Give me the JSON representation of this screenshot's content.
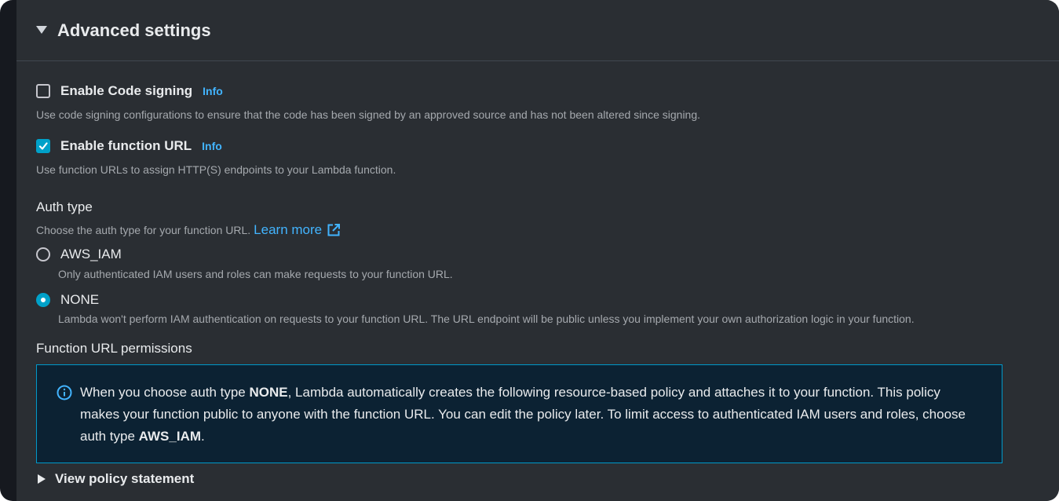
{
  "section": {
    "title": "Advanced settings"
  },
  "code_signing": {
    "label": "Enable Code signing",
    "info": "Info",
    "checked": false,
    "description": "Use code signing configurations to ensure that the code has been signed by an approved source and has not been altered since signing."
  },
  "function_url": {
    "label": "Enable function URL",
    "info": "Info",
    "checked": true,
    "description": "Use function URLs to assign HTTP(S) endpoints to your Lambda function."
  },
  "auth_type": {
    "label": "Auth type",
    "description": "Choose the auth type for your function URL.",
    "learn_more": "Learn more",
    "options": [
      {
        "label": "AWS_IAM",
        "description": "Only authenticated IAM users and roles can make requests to your function URL.",
        "selected": false
      },
      {
        "label": "NONE",
        "description": "Lambda won't perform IAM authentication on requests to your function URL. The URL endpoint will be public unless you implement your own authorization logic in your function.",
        "selected": true
      }
    ]
  },
  "permissions": {
    "label": "Function URL permissions",
    "alert": {
      "text_1": "When you choose auth type ",
      "bold_1": "NONE",
      "text_2": ", Lambda automatically creates the following resource-based policy and attaches it to your function. This policy makes your function public to anyone with the function URL. You can edit the policy later. To limit access to authenticated IAM users and roles, choose auth type ",
      "bold_2": "AWS_IAM",
      "text_3": "."
    }
  },
  "policy": {
    "label": "View policy statement"
  },
  "colors": {
    "accent": "#00a1c9",
    "link": "#42b4ff",
    "panel_bg": "#2a2e33",
    "alert_bg": "#0c2233",
    "alert_border": "#0099c9"
  },
  "icons": {
    "header_toggle": "caret-down-icon",
    "policy_toggle": "caret-right-icon",
    "external_link": "external-link-icon",
    "alert": "info-circle-icon",
    "checkmark": "checkmark-icon"
  }
}
